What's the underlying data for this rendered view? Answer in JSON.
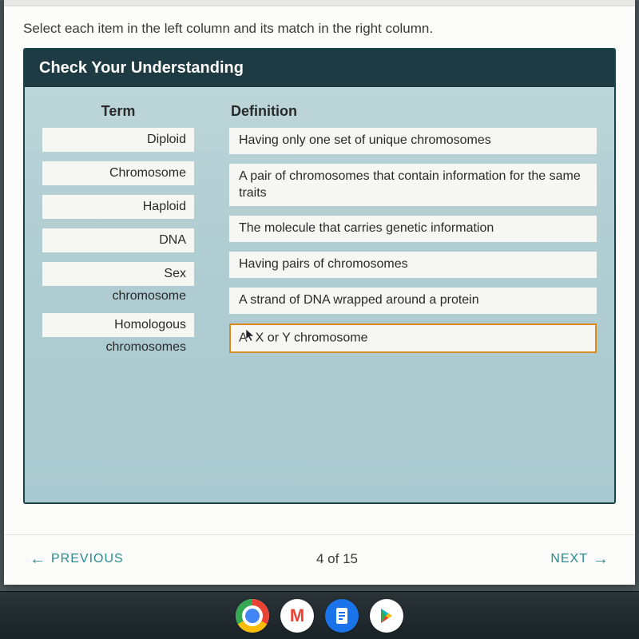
{
  "instruction": "Select each item in the left column and its match in the right column.",
  "panel_title": "Check Your Understanding",
  "headers": {
    "term": "Term",
    "definition": "Definition"
  },
  "terms": [
    {
      "label": "Diploid",
      "sub": ""
    },
    {
      "label": "Chromosome",
      "sub": ""
    },
    {
      "label": "Haploid",
      "sub": ""
    },
    {
      "label": "DNA",
      "sub": ""
    },
    {
      "label": "Sex",
      "sub": "chromosome"
    },
    {
      "label": "Homologous",
      "sub": "chromosomes"
    }
  ],
  "definitions": [
    {
      "text": "Having only one set of unique chromosomes",
      "selected": false
    },
    {
      "text": "A pair of chromosomes that contain information for the same traits",
      "selected": false
    },
    {
      "text": "The molecule that carries genetic information",
      "selected": false
    },
    {
      "text": "Having pairs of chromosomes",
      "selected": false
    },
    {
      "text": "A strand of DNA wrapped around a protein",
      "selected": false
    },
    {
      "text": "An X or Y chromosome",
      "selected": true
    }
  ],
  "nav": {
    "previous": "PREVIOUS",
    "next": "NEXT",
    "progress": "4 of 15"
  },
  "dock": {
    "chrome": "chrome-icon",
    "gmail_letter": "M",
    "docs": "docs-icon",
    "play": "play-icon"
  }
}
